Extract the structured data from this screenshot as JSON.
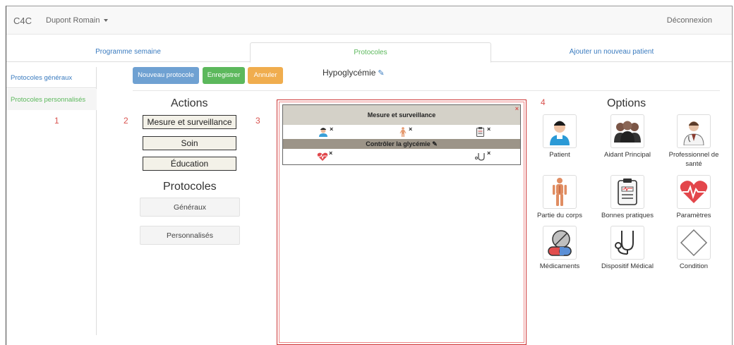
{
  "navbar": {
    "brand": "C4C",
    "user": "Dupont Romain",
    "logout": "Déconnexion"
  },
  "tabs": [
    {
      "label": "Programme semaine"
    },
    {
      "label": "Protocoles"
    },
    {
      "label": "Ajouter un nouveau patient"
    }
  ],
  "sidebar": {
    "items": [
      {
        "label": "Protocoles généraux"
      },
      {
        "label": "Protocoles personnalisés"
      }
    ]
  },
  "toolbar": {
    "new_label": "Nouveau protocole",
    "save_label": "Enregistrer",
    "cancel_label": "Annuler"
  },
  "protocol_name": "Hypoglycémie",
  "markers": {
    "m1": "1",
    "m2": "2",
    "m3": "3",
    "m4": "4"
  },
  "actions": {
    "title": "Actions",
    "items": [
      {
        "label": "Mesure et surveillance"
      },
      {
        "label": "Soin"
      },
      {
        "label": "Éducation"
      }
    ]
  },
  "protocols": {
    "title": "Protocoles",
    "items": [
      {
        "label": "Généraux"
      },
      {
        "label": "Personnalisés"
      }
    ]
  },
  "canvas": {
    "block_title": "Mesure et surveillance",
    "sub_title": "Contrôler la glycémie",
    "close": "×",
    "remove": "×"
  },
  "options": {
    "title": "Options",
    "items": [
      {
        "label": "Patient",
        "icon": "patient-icon"
      },
      {
        "label": "Aidant Principal",
        "icon": "caregiver-icon"
      },
      {
        "label": "Professionnel de santé",
        "icon": "doctor-icon"
      },
      {
        "label": "Partie du corps",
        "icon": "body-part-icon"
      },
      {
        "label": "Bonnes pratiques",
        "icon": "clipboard-icon"
      },
      {
        "label": "Paramètres",
        "icon": "heart-rate-icon"
      },
      {
        "label": "Médicaments",
        "icon": "medication-icon"
      },
      {
        "label": "Dispositif Médical",
        "icon": "stethoscope-icon"
      },
      {
        "label": "Condition",
        "icon": "diamond-icon"
      }
    ]
  },
  "colors": {
    "link": "#3a7bbf",
    "active": "#5cb85c",
    "primary": "#6fa1d2",
    "warning": "#f0ad4e",
    "danger": "#d9534f"
  }
}
